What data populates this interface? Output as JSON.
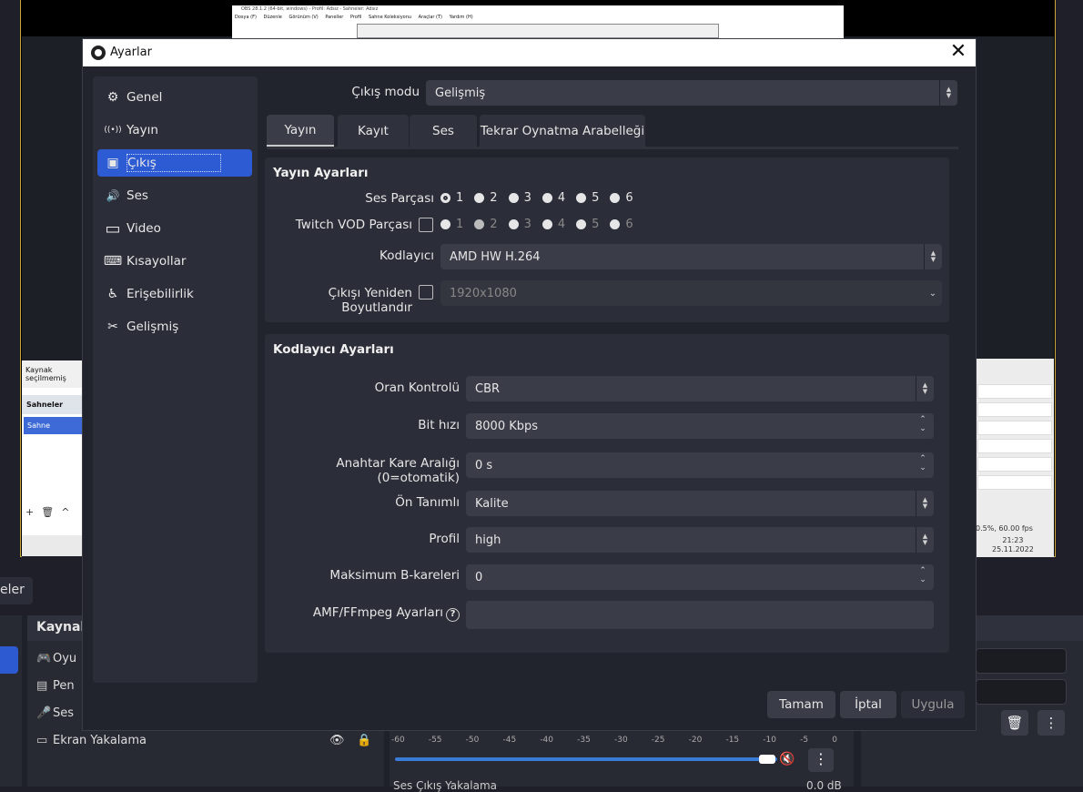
{
  "background": {
    "nested_title": "OBS 28.1.2 (64-bit, windows) - Profil: Adsız - Sahneler: Adsız",
    "nested_menu": [
      "Dosya (F)",
      "Düzenle",
      "Görünüm (V)",
      "Paneller",
      "Profil",
      "Sahne Koleksiyonu",
      "Araçlar (T)",
      "Yardım (H)"
    ],
    "inner_source_hint": "Kaynak seçilmemiş",
    "inner_scenes_header": "Sahneler",
    "inner_scene_item": "Sahne",
    "status_fps": "0.5%, 60.00 fps",
    "clock_time": "21:23",
    "clock_date": "25.11.2022",
    "left_tab_label": "eler",
    "sources_title": "Kaynak",
    "sources": [
      {
        "label": "Oyu",
        "icon": "gamepad-icon"
      },
      {
        "label": "Pen",
        "icon": "window-icon"
      },
      {
        "label": "Ses",
        "icon": "microphone-icon"
      },
      {
        "label": "Ekran Yakalama",
        "icon": "monitor-icon"
      }
    ],
    "meter_scale": [
      "-60",
      "-55",
      "-50",
      "-45",
      "-40",
      "-35",
      "-30",
      "-25",
      "-20",
      "-15",
      "-10",
      "-5",
      "0"
    ],
    "meter_label": "Ses Çıkış Yakalama",
    "meter_db": "0.0 dB"
  },
  "dialog": {
    "title": "Ayarlar",
    "close_glyph": "✕"
  },
  "sidebar": {
    "items": [
      {
        "label": "Genel",
        "icon": "gear-icon",
        "glyph": "⚙"
      },
      {
        "label": "Yayın",
        "icon": "antenna-icon",
        "glyph": "((•))"
      },
      {
        "label": "Çıkış",
        "icon": "output-icon",
        "glyph": "▣"
      },
      {
        "label": "Ses",
        "icon": "speaker-icon",
        "glyph": "🔊"
      },
      {
        "label": "Video",
        "icon": "monitor-icon",
        "glyph": "▭"
      },
      {
        "label": "Kısayollar",
        "icon": "keyboard-icon",
        "glyph": "⌨"
      },
      {
        "label": "Erişebilirlik",
        "icon": "accessibility-icon",
        "glyph": "♿"
      },
      {
        "label": "Gelişmiş",
        "icon": "tools-icon",
        "glyph": "✂"
      }
    ],
    "active_index": 2
  },
  "output_mode": {
    "label": "Çıkış modu",
    "value": "Gelişmiş"
  },
  "tabs": [
    "Yayın",
    "Kayıt",
    "Ses",
    "Tekrar Oynatma Arabelleği"
  ],
  "active_tab": 0,
  "stream_settings": {
    "title": "Yayın Ayarları",
    "audio_track_label": "Ses Parçası",
    "audio_tracks": [
      "1",
      "2",
      "3",
      "4",
      "5",
      "6"
    ],
    "audio_track_selected": "1",
    "twitch_vod_label": "Twitch VOD Parçası",
    "twitch_vod_tracks": [
      "1",
      "2",
      "3",
      "4",
      "5",
      "6"
    ],
    "encoder_label": "Kodlayıcı",
    "encoder_value": "AMD HW H.264",
    "rescale_label": "Çıkışı Yeniden Boyutlandır",
    "rescale_value": "1920x1080"
  },
  "encoder_settings": {
    "title": "Kodlayıcı Ayarları",
    "rate_control_label": "Oran Kontrolü",
    "rate_control_value": "CBR",
    "bitrate_label": "Bit hızı",
    "bitrate_value": "8000 Kbps",
    "keyframe_label": "Anahtar Kare Aralığı (0=otomatik)",
    "keyframe_value": "0 s",
    "preset_label": "Ön Tanımlı",
    "preset_value": "Kalite",
    "profile_label": "Profil",
    "profile_value": "high",
    "bframes_label": "Maksimum B-kareleri",
    "bframes_value": "0",
    "amf_label": "AMF/FFmpeg Ayarları",
    "amf_value": ""
  },
  "buttons": {
    "ok": "Tamam",
    "cancel": "İptal",
    "apply": "Uygula"
  }
}
